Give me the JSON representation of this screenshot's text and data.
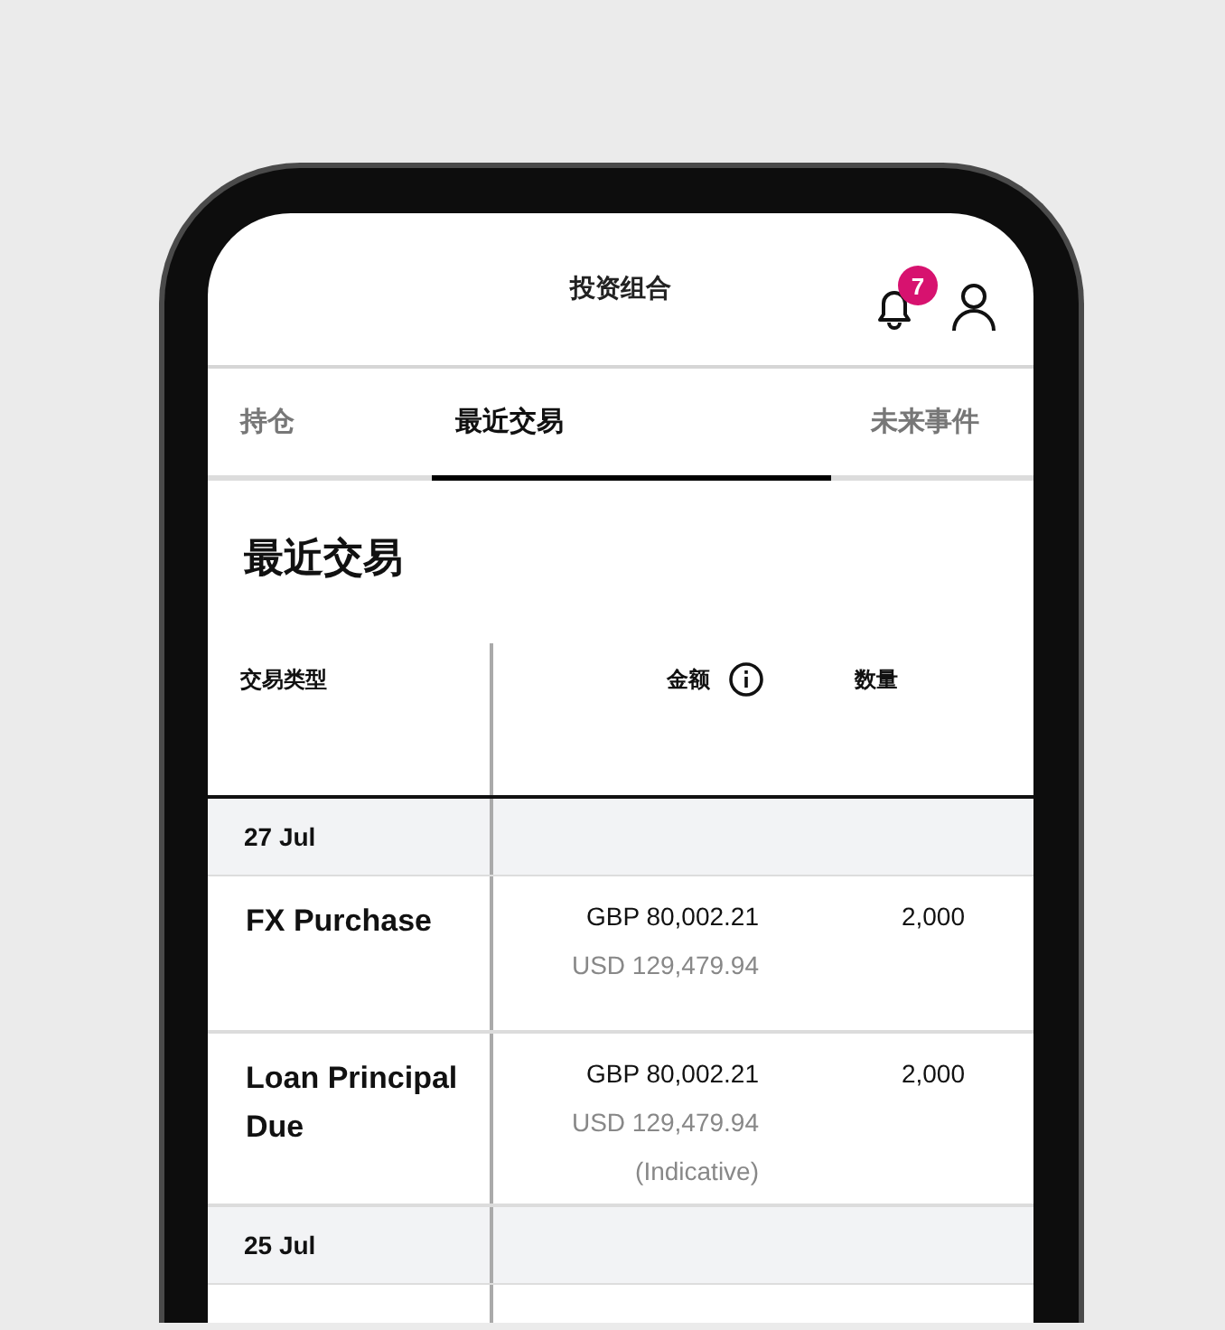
{
  "header": {
    "title": "投资组合",
    "notification_count": "7"
  },
  "tabs": [
    {
      "label": "持仓",
      "selected": false
    },
    {
      "label": "最近交易",
      "selected": true
    },
    {
      "label": "未来事件",
      "selected": false
    }
  ],
  "section_title": "最近交易",
  "table": {
    "columns": [
      {
        "label": "交易类型",
        "info": false
      },
      {
        "label": "金额",
        "info": true
      },
      {
        "label": "数量",
        "info": false
      }
    ],
    "groups": [
      {
        "date": "27 Jul",
        "rows": [
          {
            "type": "FX Purchase",
            "amount": "GBP 80,002.21",
            "converted": "USD 129,479.94",
            "quantity": "2,000"
          },
          {
            "type": "Loan Principal Due",
            "amount": "GBP 80,002.21",
            "converted": "USD 129,479.94",
            "note": "(Indicative)",
            "quantity": "2,000"
          }
        ]
      },
      {
        "date": "25 Jul"
      }
    ]
  }
}
